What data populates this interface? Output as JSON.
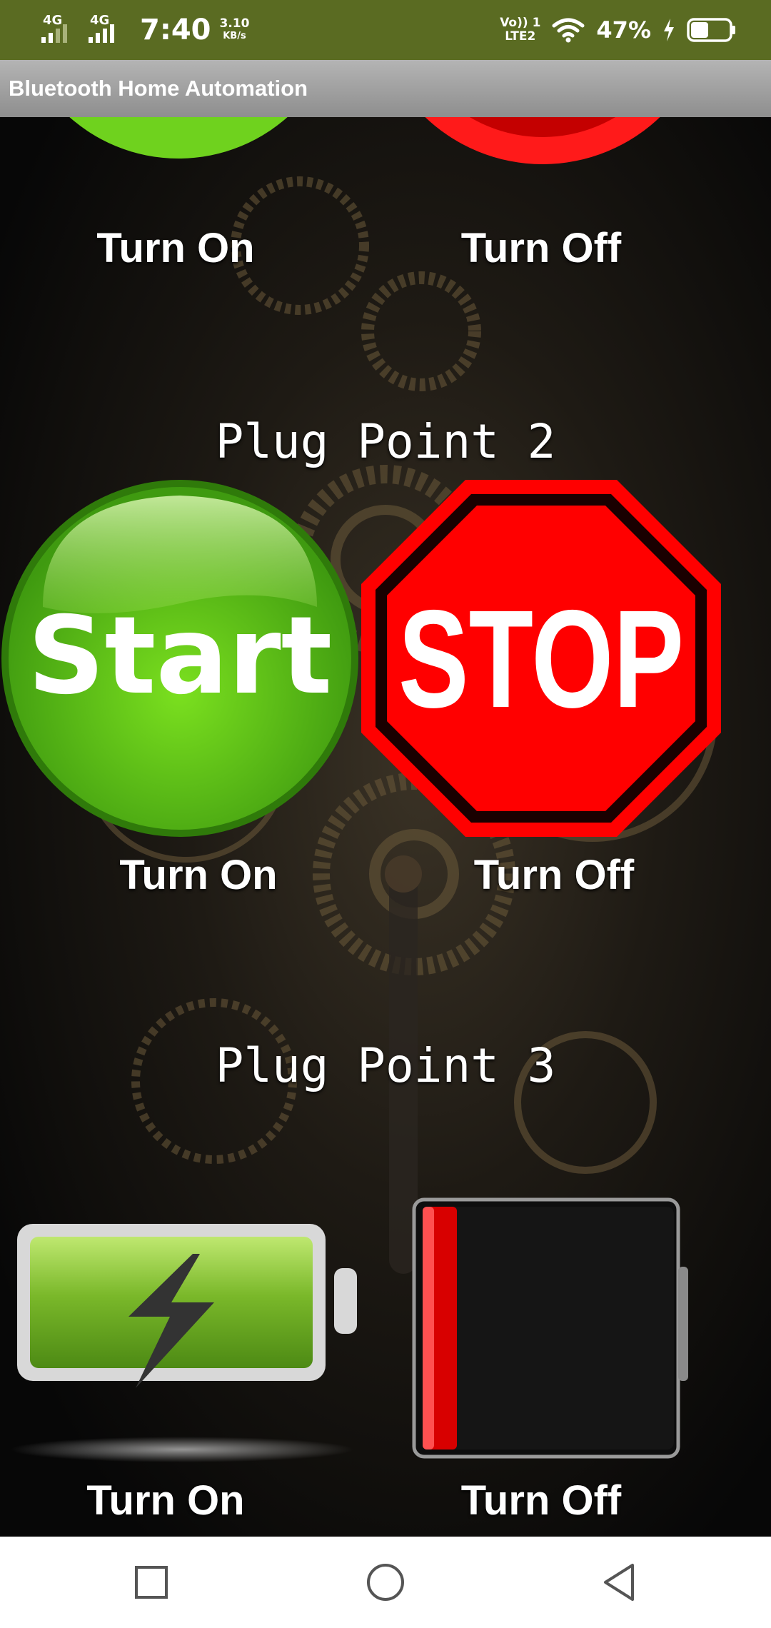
{
  "status_bar": {
    "net1": "4G",
    "net2": "4G",
    "time": "7:40",
    "speed_value": "3.10",
    "speed_unit": "KB/s",
    "volte_top": "Vo)) 1",
    "volte_bottom": "LTE2",
    "battery_percent": "47%",
    "battery_level": 0.47,
    "icons": [
      "signal-icon",
      "signal-icon",
      "wifi-icon",
      "charging-icon",
      "battery-icon"
    ]
  },
  "app": {
    "title": "Bluetooth Home Automation"
  },
  "plug_point_1": {
    "on_label": "Turn On",
    "off_label": "Turn Off"
  },
  "plug_point_2": {
    "heading": "Plug Point 2",
    "on_button_text": "Start",
    "off_button_text": "STOP",
    "on_label": "Turn On",
    "off_label": "Turn Off"
  },
  "plug_point_3": {
    "heading": "Plug Point 3",
    "on_label": "Turn On",
    "off_label": "Turn Off"
  },
  "colors": {
    "status_bar": "#5a6b22",
    "title_bar": "#9e9e9e",
    "on_green": "#5cc21a",
    "off_red": "#ff0000"
  },
  "nav_bar": {
    "icons": [
      "recents-icon",
      "home-icon",
      "back-icon"
    ]
  }
}
